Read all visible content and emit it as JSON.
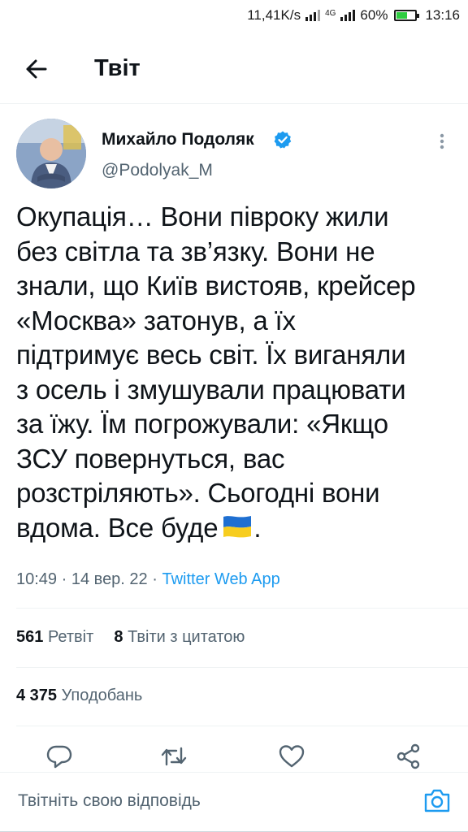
{
  "status_bar": {
    "speed": "11,41K/s",
    "network": "4G",
    "battery": "60%",
    "battery_level": 0.6,
    "time": "13:16"
  },
  "header": {
    "back_icon": "arrow-left-icon",
    "title": "Твіт"
  },
  "tweet": {
    "author_name": "Михайло Подоляк",
    "handle": "@Podolyak_M",
    "verified": true,
    "text_lines": [
      "Окупація… Вони півроку жили",
      "без світла та зв’язку. Вони не",
      "знали, що Київ вистояв, крейсер",
      "«Москва» затонув, а їх",
      "підтримує весь світ. Їх виганяли",
      "з осель і змушували працювати",
      "за їжу. Їм погрожували: «Якщо",
      "ЗСУ повернуться, вас",
      "розстріляють». Сьогодні вони",
      "вдома. Все буде"
    ],
    "text_end_emoji": "ukraine-flag-emoji",
    "text_final_punct": ".",
    "time": "10:49",
    "date": "14 вер. 22",
    "separator": "·",
    "source": "Twitter Web App"
  },
  "stats": {
    "retweets_count": "561",
    "retweets_label": "Ретвіт",
    "quotes_count": "8",
    "quotes_label": "Твіти з цитатою",
    "likes_count": "4 375",
    "likes_label": "Уподобань"
  },
  "actions": [
    {
      "name": "reply-icon"
    },
    {
      "name": "retweet-icon"
    },
    {
      "name": "like-icon"
    },
    {
      "name": "share-icon"
    }
  ],
  "reply": {
    "placeholder": "Твітніть свою відповідь",
    "camera_icon": "camera-icon"
  },
  "colors": {
    "accent": "#1d9bf0",
    "text": "#0f1419",
    "secondary": "#536471",
    "divider": "#eff3f4"
  }
}
